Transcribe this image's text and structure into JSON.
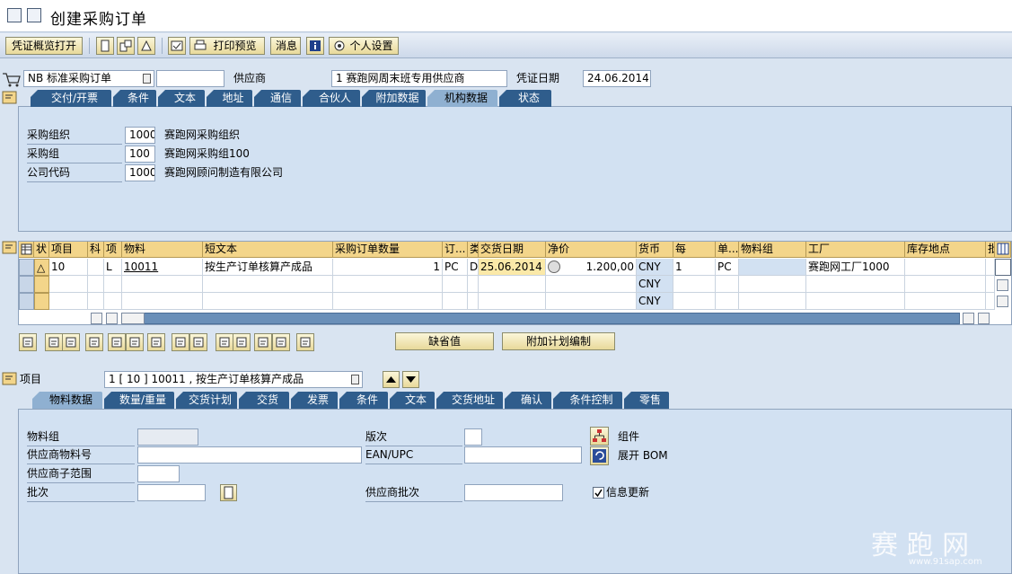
{
  "window": {
    "title": "创建采购订单"
  },
  "toolbar": {
    "doc_overview": "凭证概览打开",
    "print_preview": "打印预览",
    "messages": "消息",
    "personal_settings": "个人设置"
  },
  "header": {
    "order_type": "NB 标准采购订单",
    "order_no": "",
    "vendor_label": "供应商",
    "vendor_value": "1 赛跑网周末班专用供应商",
    "doc_date_label": "凭证日期",
    "doc_date_value": "24.06.2014"
  },
  "header_tabs": [
    "交付/开票",
    "条件",
    "文本",
    "地址",
    "通信",
    "合伙人",
    "附加数据",
    "机构数据",
    "状态"
  ],
  "header_active_tab": "机构数据",
  "org_data": [
    {
      "label": "采购组织",
      "code": "1000",
      "desc": "赛跑网采购组织"
    },
    {
      "label": "采购组",
      "code": "100",
      "desc": "赛跑网采购组100"
    },
    {
      "label": "公司代码",
      "code": "1000",
      "desc": "赛跑网顾问制造有限公司"
    }
  ],
  "grid": {
    "columns": [
      "状",
      "项目",
      "科",
      "项",
      "物料",
      "短文本",
      "采购订单数量",
      "订...",
      "类",
      "交货日期",
      "净价",
      "货币",
      "每",
      "单...",
      "物料组",
      "工厂",
      "库存地点",
      "批"
    ],
    "rows": [
      {
        "status": "△",
        "item": "10",
        "acct": "",
        "cat": "L",
        "material": "10011",
        "short_text": "按生产订单核算产成品",
        "qty": "1",
        "unit": "PC",
        "dtype": "D",
        "delivery_date": "25.06.2014",
        "net_price": "1.200,00",
        "currency": "CNY",
        "per": "1",
        "order_unit": "PC",
        "mat_group": "",
        "plant": "赛跑网工厂1000",
        "storage": ""
      },
      {
        "currency": "CNY"
      },
      {
        "currency": "CNY"
      }
    ]
  },
  "grid_buttons": {
    "default_values": "缺省值",
    "additional_planning": "附加计划编制"
  },
  "item_selector": {
    "label": "项目",
    "value": "1 [ 10 ] 10011 , 按生产订单核算产成品"
  },
  "item_tabs": [
    "物料数据",
    "数量/重量",
    "交货计划",
    "交货",
    "发票",
    "条件",
    "文本",
    "交货地址",
    "确认",
    "条件控制",
    "零售"
  ],
  "item_active_tab": "物料数据",
  "material_data": {
    "mat_group_label": "物料组",
    "vendor_mat_label": "供应商物料号",
    "vendor_subrange_label": "供应商子范围",
    "batch_label": "批次",
    "revision_label": "版次",
    "ean_label": "EAN/UPC",
    "vendor_batch_label": "供应商批次",
    "components_label": "组件",
    "explode_bom_label": "展开 BOM",
    "info_update_label": "信息更新",
    "info_update_checked": true
  },
  "watermark": {
    "brand": "赛 跑 网",
    "url": "www.91sap.com"
  }
}
